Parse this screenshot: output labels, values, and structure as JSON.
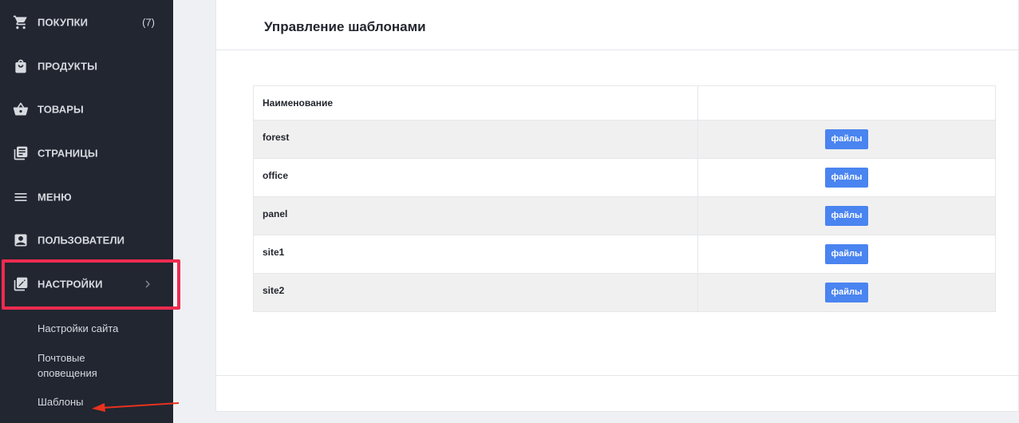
{
  "sidebar": {
    "items": [
      {
        "label": "ПОКУПКИ",
        "count": "(7)",
        "icon": "cart-icon"
      },
      {
        "label": "ПРОДУКТЫ",
        "icon": "shopping-bag-icon"
      },
      {
        "label": "ТОВАРЫ",
        "icon": "basket-icon"
      },
      {
        "label": "СТРАНИЦЫ",
        "icon": "pages-icon"
      },
      {
        "label": "МЕНЮ",
        "icon": "menu-icon"
      },
      {
        "label": "ПОЛЬЗОВАТЕЛИ",
        "icon": "user-card-icon"
      },
      {
        "label": "НАСТРОЙКИ",
        "icon": "settings-edit-icon"
      }
    ],
    "subitems": [
      {
        "label": "Настройки сайта"
      },
      {
        "label": "Почтовые оповещения"
      },
      {
        "label": "Шаблоны"
      }
    ]
  },
  "main": {
    "title": "Управление шаблонами",
    "table": {
      "header": "Наименование",
      "button_label": "файлы",
      "rows": [
        {
          "name": "forest"
        },
        {
          "name": "office"
        },
        {
          "name": "panel"
        },
        {
          "name": "site1"
        },
        {
          "name": "site2"
        }
      ]
    }
  },
  "colors": {
    "sidebar_bg": "#212631",
    "highlight": "#ee2b4f",
    "button": "#4a84f0",
    "arrow": "#e8321e"
  }
}
